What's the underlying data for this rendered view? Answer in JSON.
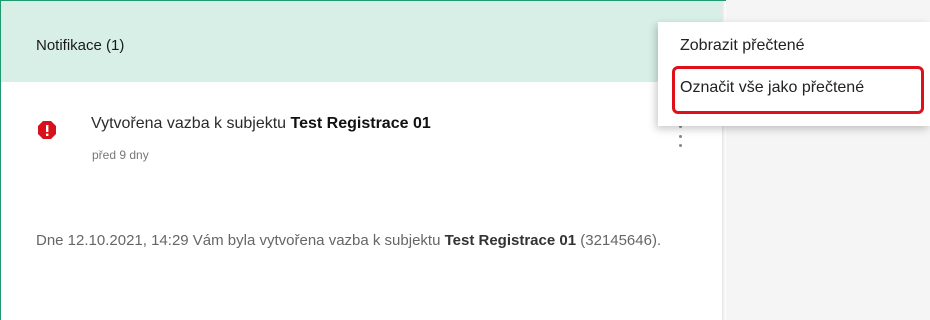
{
  "panel": {
    "title": "Notifikace (1)"
  },
  "notification": {
    "icon": "alert-octagon-icon",
    "icon_color": "#d8121c",
    "title_prefix": "Vytvořena vazba k subjektu ",
    "title_subject": "Test Registrace 01",
    "time": "před 9 dny",
    "body_prefix": "Dne 12.10.2021, 14:29 Vám byla vytvořena vazba k subjektu ",
    "body_subject": "Test Registrace 01",
    "body_suffix": " (32145646)."
  },
  "menu": {
    "items": [
      {
        "label": "Zobrazit přečtené"
      },
      {
        "label": "Označit vše jako přečtené"
      }
    ]
  },
  "colors": {
    "header_bg": "#d7efe7",
    "border": "#1f9a6c",
    "highlight": "#e0101a"
  }
}
